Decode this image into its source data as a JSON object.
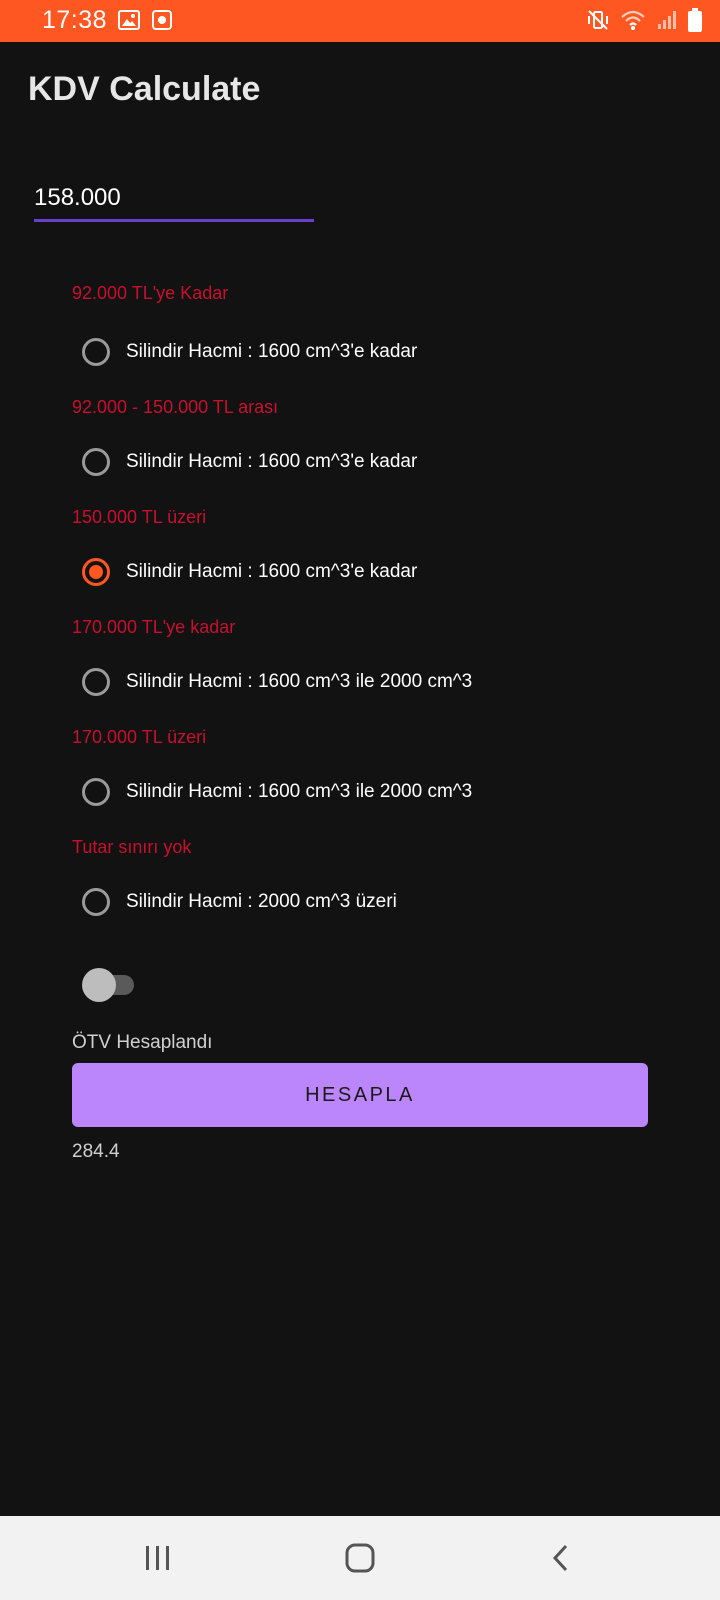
{
  "status_bar": {
    "time": "17:38",
    "left_icons": [
      "image-icon",
      "record-icon"
    ],
    "right_icons": [
      "mute-vibrate-icon",
      "wifi-icon",
      "signal-icon",
      "battery-icon"
    ],
    "color": "#ff5722"
  },
  "app": {
    "title": "KDV Calculate"
  },
  "input": {
    "value": "158.000"
  },
  "groups": [
    {
      "label": "92.000 TL'ye Kadar",
      "option": "Silindir Hacmi : 1600 cm^3'e kadar",
      "checked": false
    },
    {
      "label": "92.000 - 150.000 TL arası",
      "option": "Silindir Hacmi : 1600 cm^3'e kadar",
      "checked": false
    },
    {
      "label": "150.000 TL üzeri",
      "option": "Silindir Hacmi : 1600 cm^3'e kadar",
      "checked": true
    },
    {
      "label": "170.000 TL'ye kadar",
      "option": "Silindir Hacmi : 1600 cm^3 ile 2000 cm^3",
      "checked": false
    },
    {
      "label": "170.000 TL üzeri",
      "option": "Silindir Hacmi : 1600 cm^3 ile 2000 cm^3",
      "checked": false
    },
    {
      "label": "Tutar sınırı yok",
      "option": "Silindir Hacmi : 2000 cm^3 üzeri",
      "checked": false
    }
  ],
  "switch": {
    "label": "ÖTV Hesaplandı",
    "on": false
  },
  "button": {
    "label": "HESAPLA"
  },
  "result": {
    "value": "284.4"
  },
  "nav_bar": {
    "icons": [
      "recents-icon",
      "home-icon",
      "back-icon"
    ]
  },
  "colors": {
    "background": "#121212",
    "accent": "#ff5722",
    "label_red": "#c8102e",
    "button": "#bb86fc",
    "input_underline": "#6a3fd0"
  }
}
